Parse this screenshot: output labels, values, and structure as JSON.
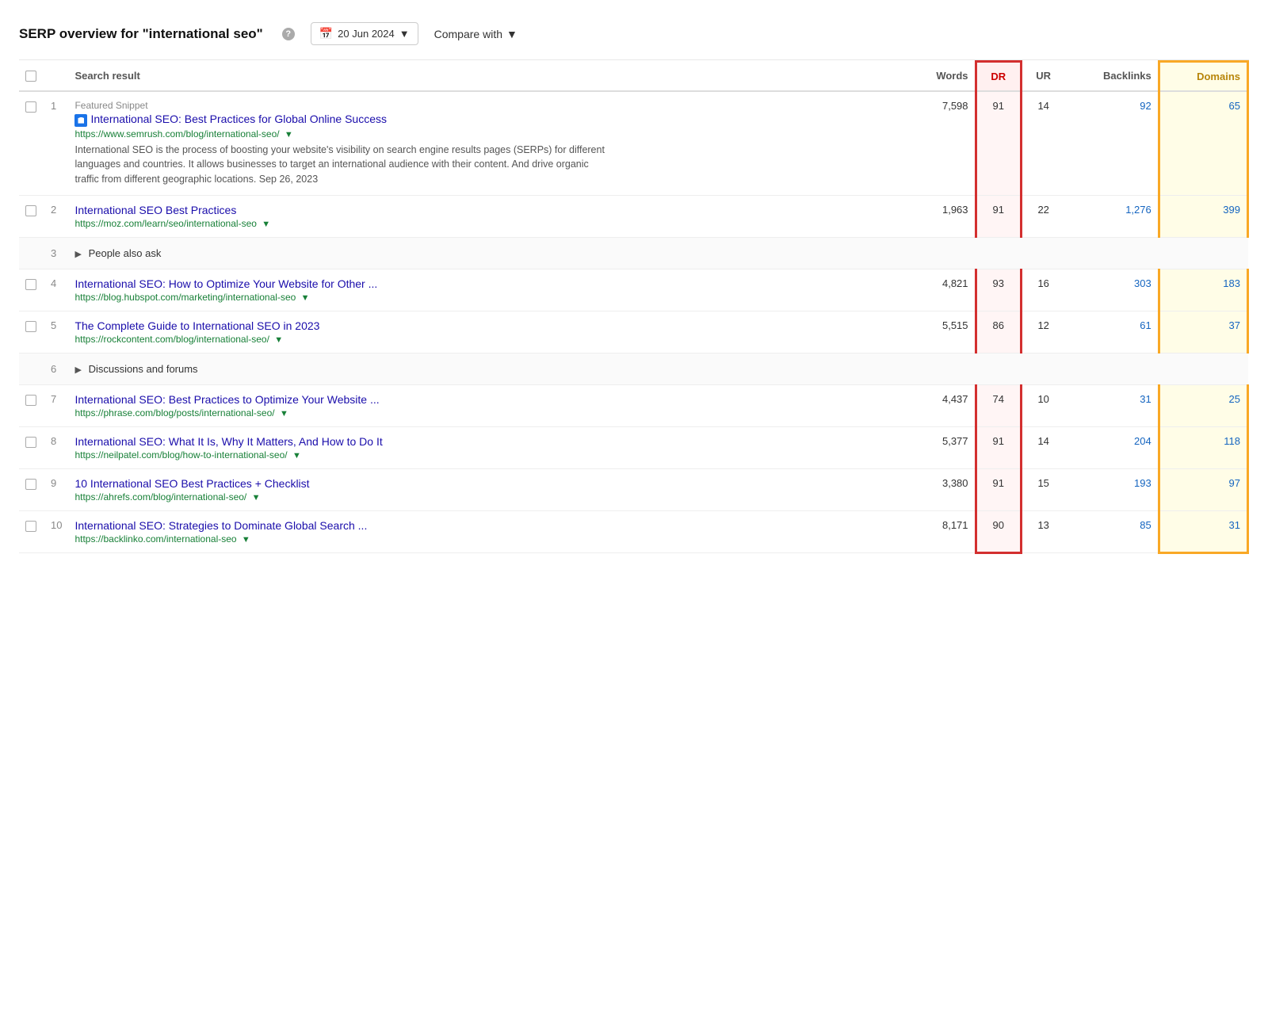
{
  "header": {
    "title": "SERP overview for \"international seo\"",
    "help_label": "?",
    "date": "20 Jun 2024",
    "compare_label": "Compare with",
    "dropdown_arrow": "▼"
  },
  "table": {
    "columns": [
      {
        "id": "check",
        "label": ""
      },
      {
        "id": "num",
        "label": ""
      },
      {
        "id": "result",
        "label": "Search result"
      },
      {
        "id": "words",
        "label": "Words"
      },
      {
        "id": "dr",
        "label": "DR"
      },
      {
        "id": "ur",
        "label": "UR"
      },
      {
        "id": "backlinks",
        "label": "Backlinks"
      },
      {
        "id": "domains",
        "label": "Domains"
      }
    ],
    "rows": [
      {
        "type": "result",
        "num": 1,
        "has_checkbox": true,
        "featured_snippet_label": "Featured Snippet",
        "title": "International SEO: Best Practices for Global Online Success",
        "url": "https://www.semrush.com/blog/international-seo/",
        "has_favicon": true,
        "snippet": "International SEO is the process of boosting your website's visibility on search engine results pages (SERPs) for different languages and countries. It allows businesses to target an international audience with their content. And drive organic traffic from different geographic locations. Sep 26, 2023",
        "words": "7,598",
        "dr": "91",
        "ur": "14",
        "backlinks": "92",
        "domains": "65"
      },
      {
        "type": "result",
        "num": 2,
        "has_checkbox": true,
        "title": "International SEO Best Practices",
        "url": "https://moz.com/learn/seo/international-seo",
        "snippet": "",
        "words": "1,963",
        "dr": "91",
        "ur": "22",
        "backlinks": "1,276",
        "domains": "399"
      },
      {
        "type": "expandable",
        "num": 3,
        "label": "People also ask",
        "has_checkbox": false
      },
      {
        "type": "result",
        "num": 4,
        "has_checkbox": true,
        "title": "International SEO: How to Optimize Your Website for Other ...",
        "url": "https://blog.hubspot.com/marketing/international-seo",
        "snippet": "",
        "words": "4,821",
        "dr": "93",
        "ur": "16",
        "backlinks": "303",
        "domains": "183"
      },
      {
        "type": "result",
        "num": 5,
        "has_checkbox": true,
        "title": "The Complete Guide to International SEO in 2023",
        "url": "https://rockcontent.com/blog/international-seo/",
        "snippet": "",
        "words": "5,515",
        "dr": "86",
        "ur": "12",
        "backlinks": "61",
        "domains": "37"
      },
      {
        "type": "expandable",
        "num": 6,
        "label": "Discussions and forums",
        "has_checkbox": false
      },
      {
        "type": "result",
        "num": 7,
        "has_checkbox": true,
        "title": "International SEO: Best Practices to Optimize Your Website ...",
        "url": "https://phrase.com/blog/posts/international-seo/",
        "snippet": "",
        "words": "4,437",
        "dr": "74",
        "ur": "10",
        "backlinks": "31",
        "domains": "25"
      },
      {
        "type": "result",
        "num": 8,
        "has_checkbox": true,
        "title": "International SEO: What It Is, Why It Matters, And How to Do It",
        "url": "https://neilpatel.com/blog/how-to-international-seo/",
        "snippet": "",
        "words": "5,377",
        "dr": "91",
        "ur": "14",
        "backlinks": "204",
        "domains": "118"
      },
      {
        "type": "result",
        "num": 9,
        "has_checkbox": true,
        "title": "10 International SEO Best Practices + Checklist",
        "url": "https://ahrefs.com/blog/international-seo/",
        "snippet": "",
        "words": "3,380",
        "dr": "91",
        "ur": "15",
        "backlinks": "193",
        "domains": "97"
      },
      {
        "type": "result",
        "num": 10,
        "has_checkbox": true,
        "title": "International SEO: Strategies to Dominate Global Search ...",
        "url": "https://backlinko.com/international-seo",
        "snippet": "",
        "words": "8,171",
        "dr": "90",
        "ur": "13",
        "backlinks": "85",
        "domains": "31",
        "is_last": true
      }
    ]
  }
}
